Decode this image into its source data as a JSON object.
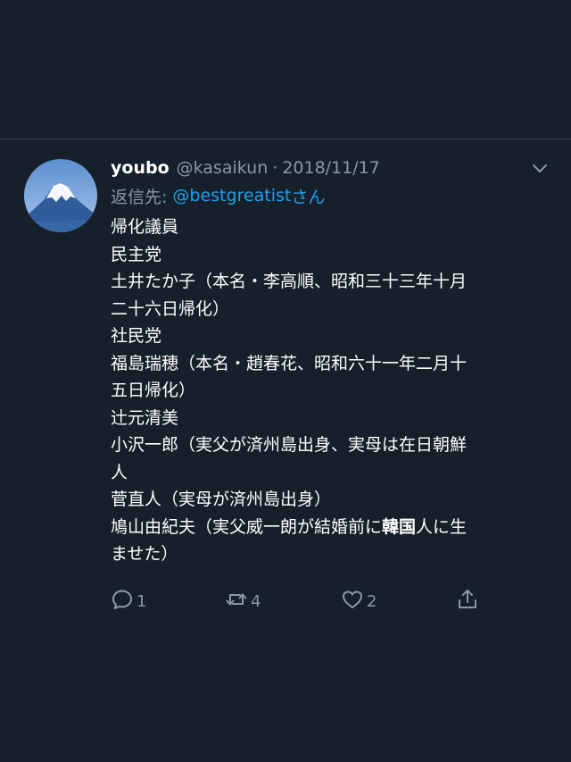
{
  "tweet": {
    "display_name": "youbo",
    "handle": "@kasaikun",
    "separator": "·",
    "date": "2018/11/17",
    "reply_prefix": "返信先:",
    "reply_mention": "@bestgreatist",
    "reply_suffix": "さん",
    "body_lines": [
      "帰化議員",
      "民主党",
      "土井たか子（本名・李高順、昭和三十三年十月",
      "二十六日帰化）",
      "社民党",
      "福島瑞穂（本名・趙春花、昭和六十一年二月十",
      "五日帰化）",
      "辻元清美",
      "小沢一郎（実父が済州島出身、実母は在日朝鮮",
      "人",
      "菅直人（実母が済州島出身）"
    ],
    "last_line_pre": "鳩山由紀夫（実父威一朗が結婚前に",
    "last_line_bold": "韓国",
    "last_line_post": "人に生",
    "final_line": "ませた）"
  },
  "actions": {
    "reply_count": "1",
    "retweet_count": "4",
    "like_count": "2"
  },
  "colors": {
    "background": "#15202b",
    "secondary_text": "#8899a6",
    "accent": "#1da1f2",
    "divider": "#38444d"
  },
  "icons": {
    "menu": "chevron-down-icon",
    "reply": "reply-bubble-icon",
    "retweet": "retweet-icon",
    "like": "heart-icon",
    "share": "share-icon"
  }
}
